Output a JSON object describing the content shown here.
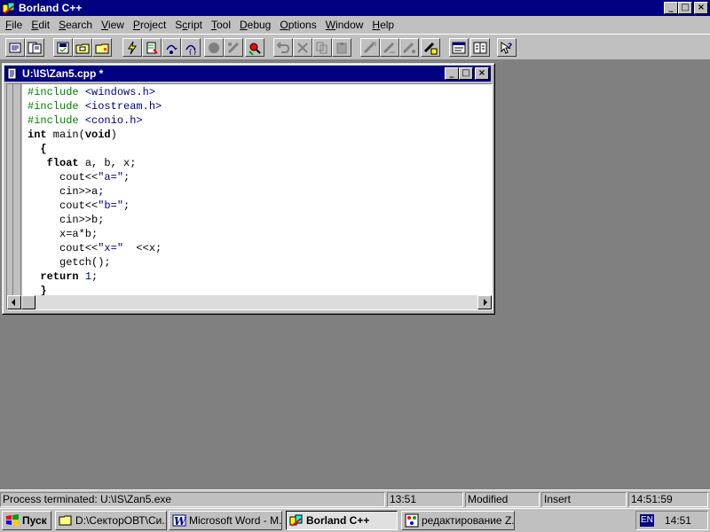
{
  "app": {
    "title": "Borland C++",
    "controls": {
      "minimize": "_",
      "maximize": "□",
      "close": "×"
    }
  },
  "menu": {
    "items": [
      {
        "label": "File",
        "accel": "F"
      },
      {
        "label": "Edit",
        "accel": "E"
      },
      {
        "label": "Search",
        "accel": "S"
      },
      {
        "label": "View",
        "accel": "V"
      },
      {
        "label": "Project",
        "accel": "P"
      },
      {
        "label": "Script",
        "accel": "c"
      },
      {
        "label": "Tool",
        "accel": "T"
      },
      {
        "label": "Debug",
        "accel": "D"
      },
      {
        "label": "Options",
        "accel": "O"
      },
      {
        "label": "Window",
        "accel": "W"
      },
      {
        "label": "Help",
        "accel": "H"
      }
    ]
  },
  "toolbar": {
    "buttons": [
      {
        "icon": "open-project-icon",
        "enabled": true
      },
      {
        "icon": "open-file-icon",
        "enabled": true
      },
      {
        "icon": "save-icon",
        "enabled": true
      },
      {
        "icon": "save-all-icon",
        "enabled": true
      },
      {
        "icon": "print-icon",
        "enabled": true
      },
      {
        "icon": "run-lightning-icon",
        "enabled": true
      },
      {
        "icon": "compile-icon",
        "enabled": true
      },
      {
        "icon": "step-over-icon",
        "enabled": true
      },
      {
        "icon": "trace-into-icon",
        "enabled": true
      },
      {
        "icon": "breakpoint-icon",
        "enabled": false
      },
      {
        "icon": "watch-icon",
        "enabled": false
      },
      {
        "icon": "inspect-icon",
        "enabled": true
      },
      {
        "icon": "undo-icon",
        "enabled": false
      },
      {
        "icon": "cut-icon",
        "enabled": false
      },
      {
        "icon": "copy-icon",
        "enabled": false
      },
      {
        "icon": "paste-icon",
        "enabled": false
      },
      {
        "icon": "find-icon",
        "enabled": false
      },
      {
        "icon": "replace-icon",
        "enabled": false
      },
      {
        "icon": "search-again-icon",
        "enabled": false
      },
      {
        "icon": "browse-icon",
        "enabled": true
      },
      {
        "icon": "message-window-icon",
        "enabled": true
      },
      {
        "icon": "project-window-icon",
        "enabled": true
      },
      {
        "icon": "context-help-icon",
        "enabled": true
      }
    ]
  },
  "editor": {
    "title": "U:\\IS\\Zan5.cpp *",
    "lines": [
      [
        {
          "t": "#include ",
          "c": "pp"
        },
        {
          "t": "<windows.h>",
          "c": "hdr"
        }
      ],
      [
        {
          "t": "#include ",
          "c": "pp"
        },
        {
          "t": "<iostream.h>",
          "c": "hdr"
        }
      ],
      [
        {
          "t": "#include ",
          "c": "pp"
        },
        {
          "t": "<conio.h>",
          "c": "hdr"
        }
      ],
      [
        {
          "t": "int",
          "c": "kw"
        },
        {
          "t": " main(",
          "c": ""
        },
        {
          "t": "void",
          "c": "kw"
        },
        {
          "t": ")",
          "c": ""
        }
      ],
      [
        {
          "t": "  {",
          "c": "kw"
        }
      ],
      [
        {
          "t": "   ",
          "c": ""
        },
        {
          "t": "float",
          "c": "kw"
        },
        {
          "t": " a, b, x;",
          "c": ""
        }
      ],
      [
        {
          "t": "     cout<<",
          "c": ""
        },
        {
          "t": "\"a=\"",
          "c": "str"
        },
        {
          "t": ";",
          "c": ""
        }
      ],
      [
        {
          "t": "     cin>>a;",
          "c": ""
        }
      ],
      [
        {
          "t": "     cout<<",
          "c": ""
        },
        {
          "t": "\"b=\"",
          "c": "str"
        },
        {
          "t": ";",
          "c": ""
        }
      ],
      [
        {
          "t": "     cin>>b;",
          "c": ""
        }
      ],
      [
        {
          "t": "     x=a*b;",
          "c": ""
        }
      ],
      [
        {
          "t": "     cout<<",
          "c": ""
        },
        {
          "t": "\"x=\"",
          "c": "str"
        },
        {
          "t": "  <<x;",
          "c": ""
        }
      ],
      [
        {
          "t": "     getch();",
          "c": ""
        }
      ],
      [
        {
          "t": "  ",
          "c": ""
        },
        {
          "t": "return",
          "c": "kw"
        },
        {
          "t": " ",
          "c": ""
        },
        {
          "t": "1",
          "c": "num"
        },
        {
          "t": ";",
          "c": ""
        }
      ],
      [
        {
          "t": "  }",
          "c": "kw"
        }
      ]
    ]
  },
  "statusbar": {
    "message": "Process terminated: U:\\IS\\Zan5.exe",
    "position": "13:51",
    "modified": "Modified",
    "mode": "Insert",
    "time": "14:51:59"
  },
  "taskbar": {
    "start_label": "Пуск",
    "tasks": [
      {
        "label": "D:\\СекторОВТ\\Си...",
        "icon": "folder-icon",
        "active": false
      },
      {
        "label": "Microsoft Word - М...",
        "icon": "word-icon",
        "active": false
      },
      {
        "label": "Borland C++",
        "icon": "borland-icon",
        "active": true
      },
      {
        "label": "редактирование Z...",
        "icon": "paint-icon",
        "active": false
      }
    ],
    "language": "EN",
    "clock": "14:51"
  },
  "colors": {
    "titlebar": "#000080",
    "face": "#c0c0c0",
    "desktop": "#808080",
    "preprocessor": "#008000",
    "string_literal": "#000080"
  }
}
